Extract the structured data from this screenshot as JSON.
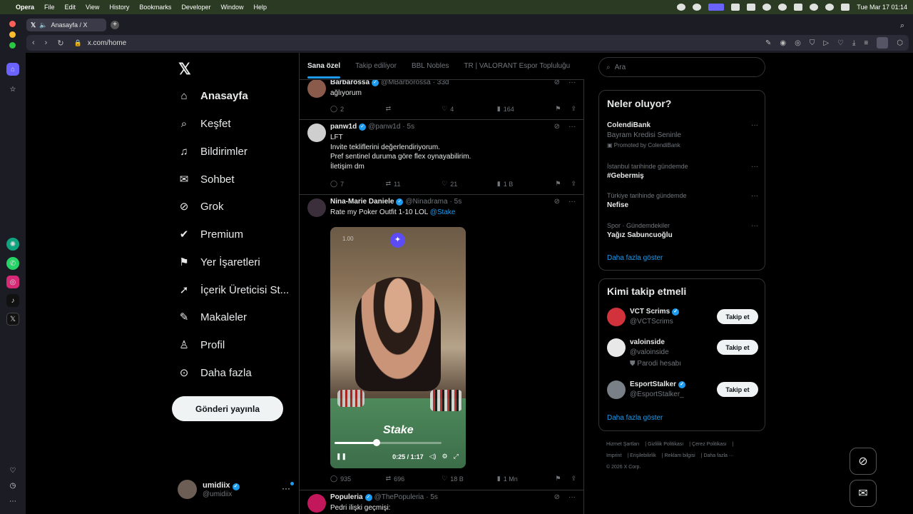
{
  "menubar": {
    "app": "Opera",
    "items": [
      "File",
      "Edit",
      "View",
      "History",
      "Bookmarks",
      "Developer",
      "Window",
      "Help"
    ],
    "datetime": "Tue Mar 17  01:14"
  },
  "browser": {
    "tab_title": "Anasayfa / X",
    "url": "x.com/home"
  },
  "nav": {
    "items": [
      {
        "label": "Anasayfa",
        "icon": "home-icon"
      },
      {
        "label": "Keşfet",
        "icon": "search-icon"
      },
      {
        "label": "Bildirimler",
        "icon": "bell-icon"
      },
      {
        "label": "Sohbet",
        "icon": "mail-icon"
      },
      {
        "label": "Grok",
        "icon": "grok-icon"
      },
      {
        "label": "Premium",
        "icon": "premium-icon"
      },
      {
        "label": "Yer İşaretleri",
        "icon": "bookmark-icon"
      },
      {
        "label": "İçerik Üreticisi St...",
        "icon": "rocket-icon"
      },
      {
        "label": "Makaleler",
        "icon": "article-icon"
      },
      {
        "label": "Profil",
        "icon": "profile-icon"
      },
      {
        "label": "Daha fazla",
        "icon": "more-circle-icon"
      }
    ],
    "post_button": "Gönderi yayınla",
    "account": {
      "name": "umidiix",
      "handle": "@umidiix"
    }
  },
  "timeline": {
    "tabs": [
      "Sana özel",
      "Takip ediliyor",
      "BBL Nobles",
      "TR | VALORANT Espor Topluluğu"
    ],
    "tweets": [
      {
        "name": "Barbarossa",
        "handle": "@MBarborossa",
        "time": "· 33d",
        "lines": [
          "ağlıyorum"
        ],
        "replies": "2",
        "retweets": "",
        "likes": "4",
        "views": "164"
      },
      {
        "name": "panw1d",
        "handle": "@panw1d",
        "time": "· 5s",
        "lines": [
          "LFT",
          "Invite tekliflerini değerlendiriyorum.",
          "Pref sentinel duruma göre flex oynayabilirim.",
          "İletişim dm"
        ],
        "replies": "7",
        "retweets": "11",
        "likes": "21",
        "views": "1 B"
      },
      {
        "name": "Nina-Marie Daniele",
        "handle": "@Ninadrama",
        "time": "· 5s",
        "text": "Rate my Poker Outfit 1-10 LOL ",
        "mention": "@Stake",
        "video": {
          "speed": "1.00",
          "time": "0:25 / 1:17",
          "logo": "Stake",
          "progress": 0.39
        },
        "replies": "935",
        "retweets": "696",
        "likes": "18 B",
        "views": "1 Mn"
      },
      {
        "name": "Populeria",
        "handle": "@ThePopuleria",
        "time": "· 5s",
        "lines": [
          "Pedri ilişki geçmişi:"
        ]
      }
    ]
  },
  "right": {
    "search_placeholder": "Ara",
    "trends_title": "Neler oluyor?",
    "trends": [
      {
        "context": "",
        "title": "ColendiBank",
        "sub": "Bayram Kredisi Seninle",
        "promo": "Promoted by ColendiBank"
      },
      {
        "context": "İstanbul tarihinde gündemde",
        "title": "#Gebermiş"
      },
      {
        "context": "Türkiye tarihinde gündemde",
        "title": "Nefise"
      },
      {
        "context": "Spor · Gündemdekiler",
        "title": "Yağız Sabuncuoğlu"
      }
    ],
    "show_more": "Daha fazla göster",
    "who_title": "Kimi takip etmeli",
    "who": [
      {
        "name": "VCT Scrims",
        "handle": "@VCTScrims",
        "extra": "",
        "follow": "Takip et"
      },
      {
        "name": "valoinside",
        "handle": "@valoinside",
        "extra": "Parodi hesabı",
        "follow": "Takip et"
      },
      {
        "name": "EsportStalker",
        "handle": "@EsportStalker_",
        "extra": "",
        "follow": "Takip et"
      }
    ],
    "footer": [
      "Hizmet Şartları",
      "Gizlilik Politikası",
      "Çerez Politikası",
      "Imprint",
      "Erişilebilirlik",
      "Reklam bilgisi",
      "Daha fazla ···",
      "© 2026 X Corp."
    ]
  },
  "colors": {
    "accent": "#1d9bf0",
    "background": "#000000",
    "border": "#2f3336",
    "muted": "#71767b"
  }
}
